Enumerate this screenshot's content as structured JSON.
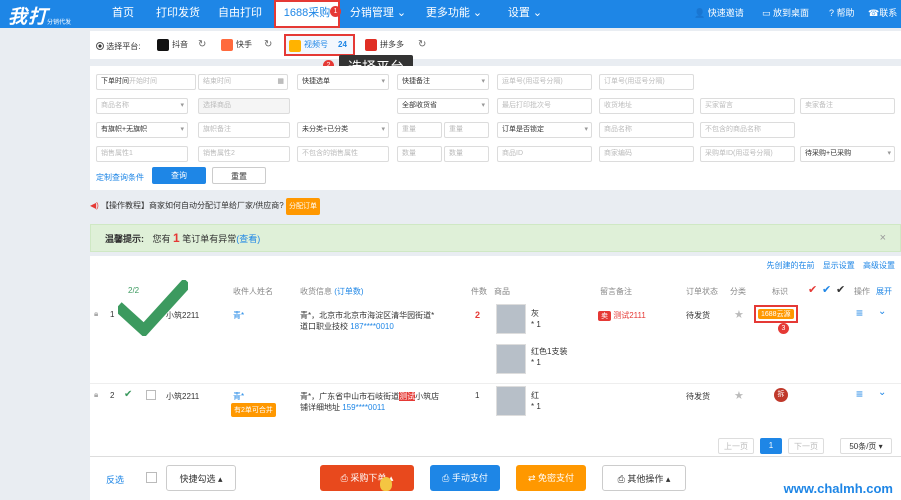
{
  "brand": {
    "logo": "我打",
    "sub": "分销代发"
  },
  "nav": {
    "items": [
      "首页",
      "打印发货",
      "自由打印",
      "1688采购",
      "分销管理",
      "更多功能",
      "设置"
    ],
    "badge": "1",
    "right": [
      "快速邀请",
      "放到桌面",
      "帮助",
      "联系"
    ]
  },
  "platforms": {
    "label": "选择平台:",
    "items": [
      {
        "name": "抖音"
      },
      {
        "name": "快手"
      },
      {
        "name": "视频号",
        "count": "24"
      },
      {
        "name": "拼多多"
      }
    ],
    "callout": "选择平台",
    "callout_num": "2"
  },
  "filters": {
    "row1": [
      "下单时间",
      "开始时间",
      "结束时间",
      "快捷选单",
      "快捷备注",
      "运单号(用逗号分隔)",
      "订单号(用逗号分隔)"
    ],
    "row2": [
      "商品名称",
      "选择商品",
      "全部收货省",
      "最后打印批次号",
      "收货地址",
      "买家留言",
      "卖家备注"
    ],
    "row3": [
      "有旗帜+无旗帜",
      "旗帜备注",
      "未分类+已分类",
      "重量",
      "重量",
      "订单是否锁定",
      "商品名称",
      "不包含的商品名称"
    ],
    "row4": [
      "销售属性1",
      "销售属性2",
      "不包含的销售属性",
      "数量",
      "数量",
      "商品ID",
      "商家编码",
      "采购单ID(用逗号分隔)",
      "待采购+已采购"
    ],
    "custom": "定制查询条件",
    "query": "查询",
    "reset": "重置"
  },
  "tip": {
    "text": "【操作教程】商家如何自动分配订单给厂家/供应商?",
    "tag": "分配订单"
  },
  "warm": {
    "label": "温馨提示:",
    "text1": "您有",
    "num": "1",
    "text2": "笔订单有异常",
    "link": "(查看)"
  },
  "toolbar": {
    "first": "先创建的在前",
    "display": "显示设置",
    "advanced": "高级设置"
  },
  "table": {
    "headers": [
      "收件人姓名",
      "收货信息",
      "(订单数)",
      "件数",
      "商品",
      "留言备注",
      "订单状态",
      "分类",
      "标识",
      "操作",
      "展开"
    ],
    "count": "2/2",
    "rows": [
      {
        "idx": "1",
        "user": "小筑2211",
        "name": "青*",
        "addr": "青*，北京市北京市海淀区清华园街道*",
        "addr2": "道口职业技校",
        "phone": "187****0010",
        "qty": "2",
        "prod1": "灰",
        "prod1q": "* 1",
        "prod2": "红色1支装",
        "prod2q": "* 1",
        "remark": "测试2111",
        "remark_tag": "卖",
        "status": "待发货",
        "mark": "1688云源",
        "mark_num": "3"
      },
      {
        "idx": "2",
        "user": "小筑2211",
        "name": "青*",
        "addr": "青*，广东省中山市石岐街道",
        "addr_hl": "测试",
        "addr_tail": "小筑店",
        "addr2": "铺详细地址",
        "phone": "159****0011",
        "qty": "1",
        "prod1": "红",
        "prod1q": "* 1",
        "merge": "有2单可合并",
        "status": "待发货",
        "mark": "拆"
      }
    ]
  },
  "pagination": {
    "prev": "上一页",
    "page": "1",
    "next": "下一页",
    "size": "50条/页"
  },
  "bottom": {
    "invert": "反选",
    "quick": "快捷勾选",
    "purchase": "采购下单",
    "manual": "手动支付",
    "free": "免密支付",
    "other": "其他操作"
  },
  "watermark": "www.chalmh.com",
  "colors": {
    "primary": "#1e86e6",
    "red": "#e53935",
    "orange": "#ff9800",
    "green": "#3c9a5f"
  }
}
